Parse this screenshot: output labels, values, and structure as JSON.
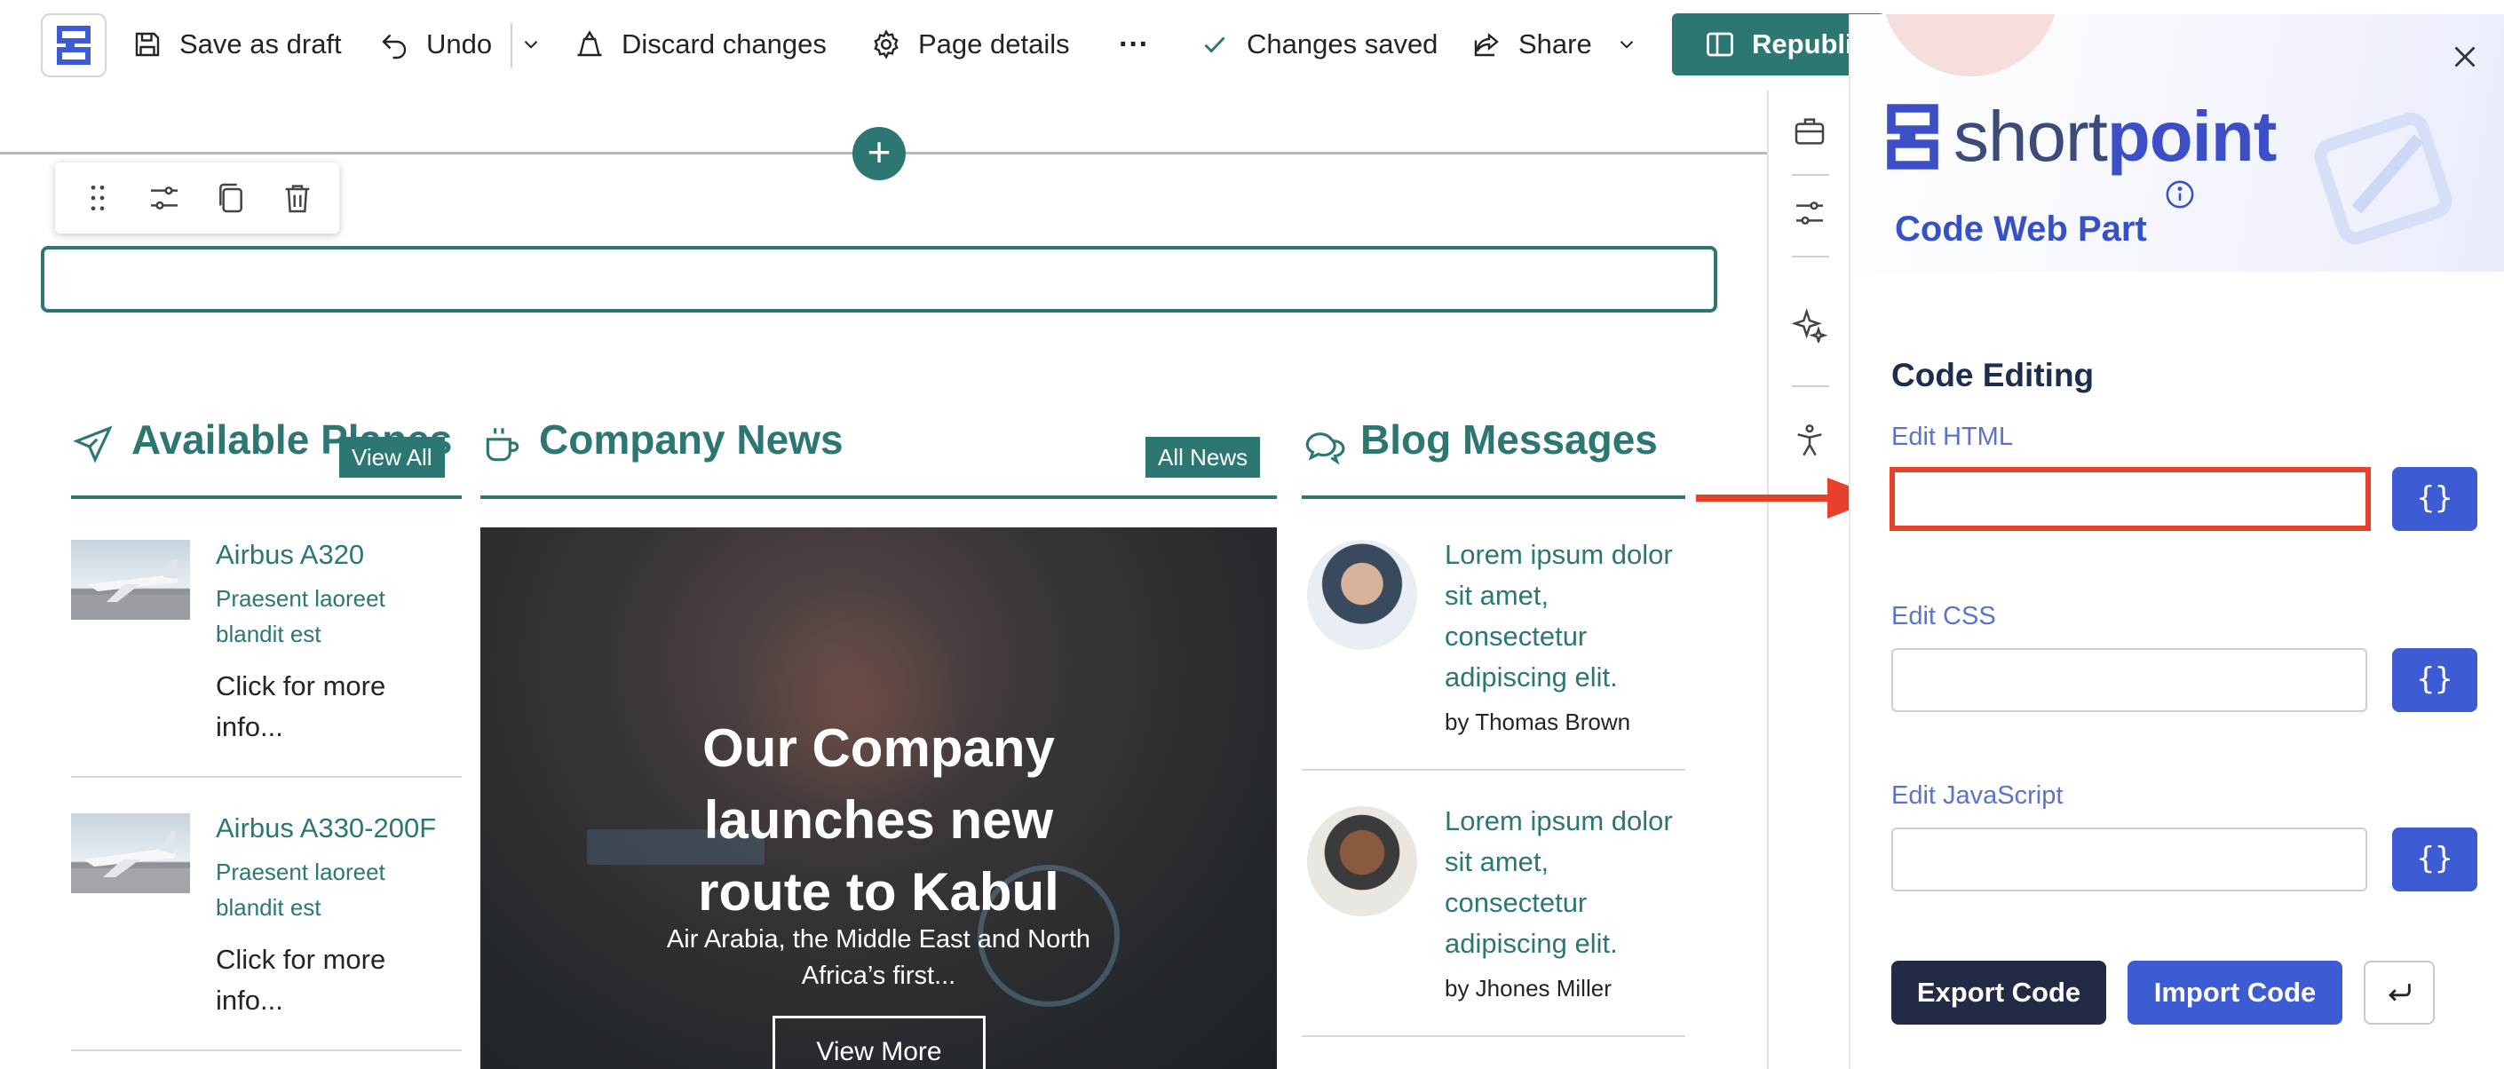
{
  "toolbar": {
    "save_draft": "Save as draft",
    "undo": "Undo",
    "discard": "Discard changes",
    "page_details": "Page details",
    "more": "···",
    "status": "Changes saved",
    "share": "Share",
    "republish": "Republish"
  },
  "columns": {
    "planes": {
      "title": "Available Planes",
      "pill": "View All",
      "items": [
        {
          "title": "Airbus A320",
          "subtitle": "Praesent laoreet blandit est",
          "link": "Click for more info..."
        },
        {
          "title": "Airbus A330-200F",
          "subtitle": "Praesent laoreet blandit est",
          "link": "Click for more info..."
        }
      ]
    },
    "news": {
      "title": "Company News",
      "pill": "All News",
      "card_title": "Our Company launches new route to Kabul",
      "card_subtitle": "Air Arabia, the Middle East and North Africa’s first...",
      "card_button": "View More"
    },
    "blog": {
      "title": "Blog Messages",
      "items": [
        {
          "title": "Lorem ipsum dolor sit amet, consectetur adipiscing elit.",
          "author": "by Thomas Brown"
        },
        {
          "title": "Lorem ipsum dolor sit amet, consectetur adipiscing elit.",
          "author": "by Jhones Miller"
        }
      ]
    }
  },
  "panel": {
    "brand_light": "short",
    "brand_bold": "point",
    "heading": "Code Web Part",
    "section": "Code Editing",
    "fields": [
      {
        "label": "Edit HTML",
        "value": ""
      },
      {
        "label": "Edit CSS",
        "value": ""
      },
      {
        "label": "Edit JavaScript",
        "value": ""
      }
    ],
    "brace": "{}",
    "export": "Export Code",
    "import": "Import Code"
  },
  "colors": {
    "teal": "#2d7773",
    "panel_blue": "#3d5bd3",
    "highlight_red": "#e8402a",
    "dark": "#242a45"
  }
}
